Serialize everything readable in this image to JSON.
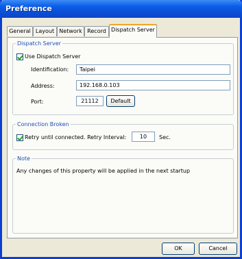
{
  "window": {
    "title": "Preference"
  },
  "tabs": [
    {
      "label": "General"
    },
    {
      "label": "Layout"
    },
    {
      "label": "Network"
    },
    {
      "label": "Record"
    },
    {
      "label": "Dispatch Server",
      "active": true
    }
  ],
  "dispatch": {
    "legend": "Dispatch Server",
    "use_label": "Use Dispatch Server",
    "use_checked": true,
    "identification_label": "Identification:",
    "identification_value": "Taipei",
    "address_label": "Address:",
    "address_value": "192.168.0.103",
    "port_label": "Port:",
    "port_value": "21112",
    "default_button": "Default"
  },
  "connection": {
    "legend": "Connection Broken",
    "retry_label": "Retry until connected. Retry Interval:",
    "retry_checked": true,
    "interval_value": "10",
    "unit": "Sec."
  },
  "note": {
    "legend": "Note",
    "text": "Any changes of this property will be applied in the next startup"
  },
  "buttons": {
    "ok": "OK",
    "cancel": "Cancel"
  },
  "colors": {
    "accent": "#0a4fd6",
    "legend": "#1f4fb5",
    "tab_highlight": "#f0a52a"
  }
}
